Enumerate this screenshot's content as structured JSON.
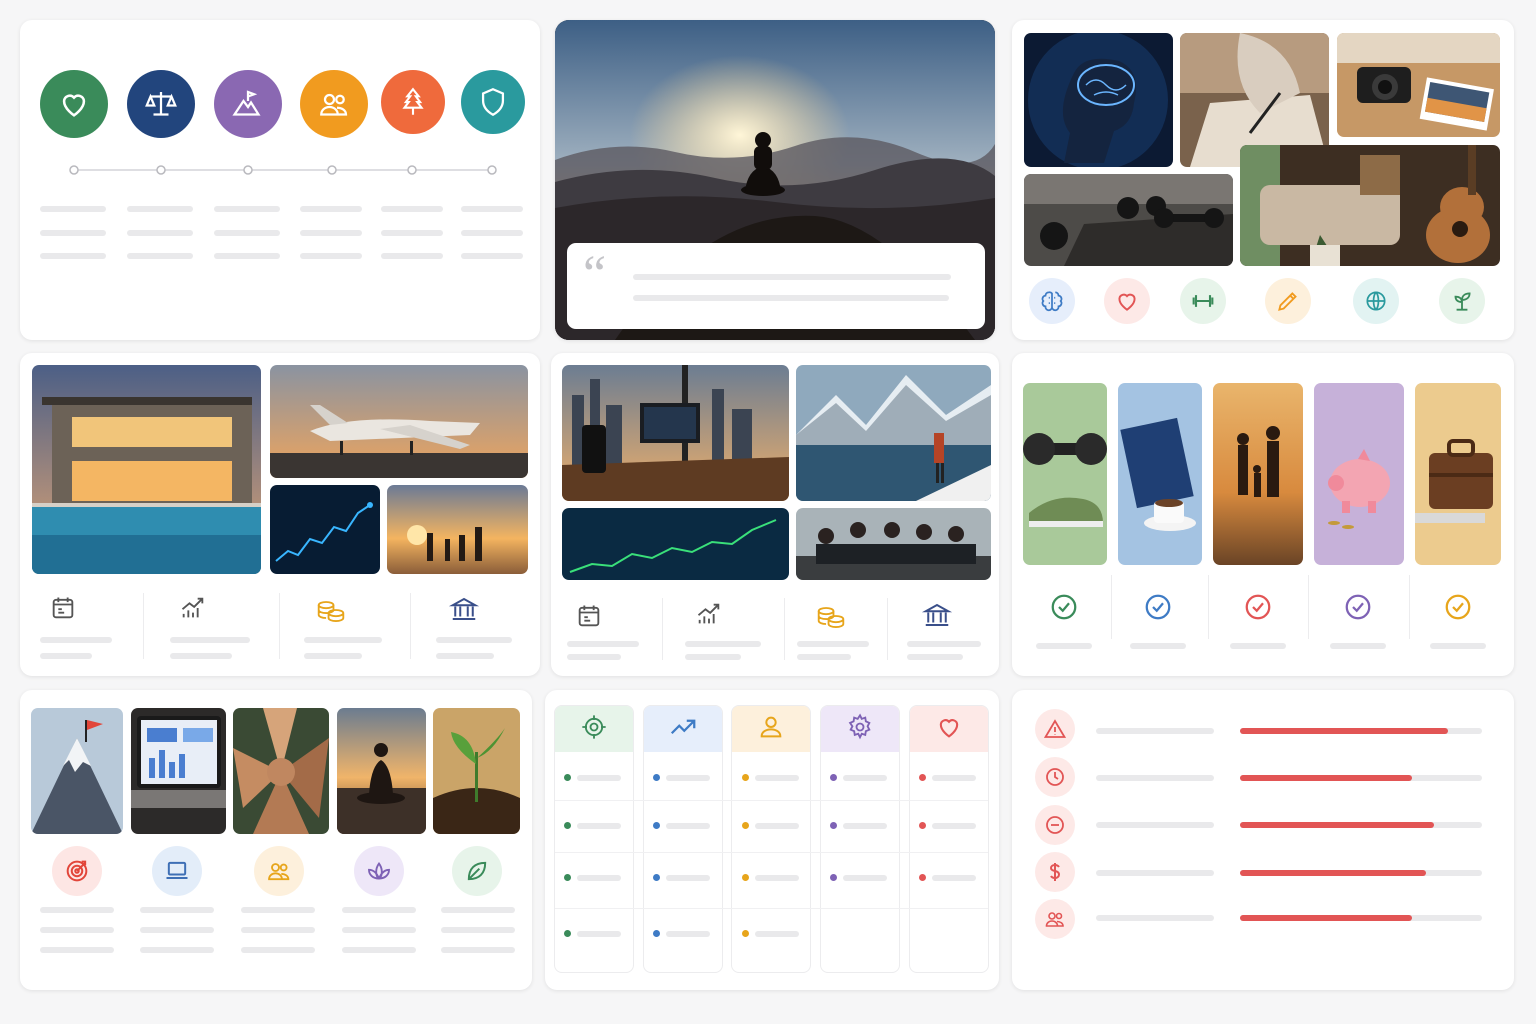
{
  "colors": {
    "green": "#3a8b5a",
    "navy": "#22457d",
    "purple": "#8a68b2",
    "orange": "#f19b1f",
    "coral": "#ef6a3c",
    "teal": "#2a9a9e",
    "red": "#e25555",
    "blue": "#3e7bc5",
    "amber": "#e7a51b",
    "violet": "#7e62b5"
  },
  "values_card": {
    "icons": [
      "heart-icon",
      "scale-icon",
      "mountain-flag-icon",
      "people-icon",
      "tree-icon",
      "shield-icon"
    ]
  },
  "quote_card": {
    "quote_mark": "“"
  },
  "growth_card": {
    "icons": [
      "brain-icon",
      "heart-icon",
      "dumbbell-icon",
      "pencil-icon",
      "globe-icon",
      "sprout-icon"
    ]
  },
  "wealth_card": {
    "icons": [
      "calendar-icon",
      "growth-chart-icon",
      "coins-icon",
      "bank-icon"
    ]
  },
  "office_card": {
    "icons": [
      "calendar-icon",
      "growth-chart-icon",
      "coins-icon",
      "bank-icon"
    ]
  },
  "checklist_card": {
    "icons": [
      "check-circle-icon",
      "check-circle-icon",
      "check-circle-icon",
      "check-circle-icon",
      "check-circle-icon"
    ]
  },
  "goals_card": {
    "icons": [
      "target-icon",
      "laptop-icon",
      "people-icon",
      "lotus-icon",
      "leaf-icon"
    ]
  },
  "kanban_card": {
    "icons": [
      "target-icon",
      "trend-icon",
      "person-icon",
      "gear-icon",
      "heart-icon"
    ],
    "dots_per_column": [
      4,
      4,
      4,
      3,
      3
    ]
  },
  "risks_card": {
    "icons": [
      "warning-icon",
      "clock-icon",
      "minus-circle-icon",
      "dollar-icon",
      "people-icon"
    ],
    "progress": [
      0.86,
      0.71,
      0.8,
      0.77,
      0.71
    ]
  }
}
